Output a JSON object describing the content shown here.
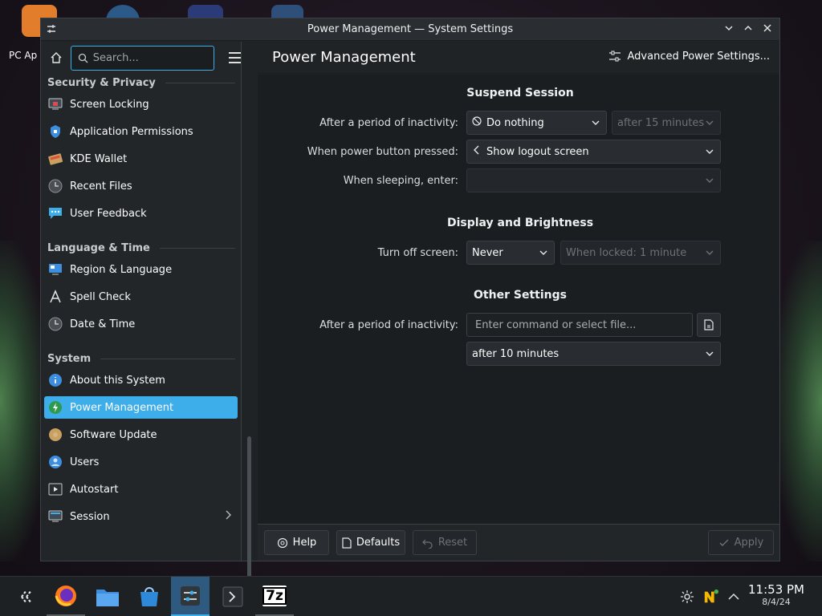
{
  "desktop": {
    "icon_label": "PC Ap"
  },
  "window": {
    "title": "Power Management — System Settings"
  },
  "sidebar": {
    "search_placeholder": "Search...",
    "sections": [
      {
        "title": "Security & Privacy"
      },
      {
        "title": "Language & Time"
      },
      {
        "title": "System"
      }
    ],
    "items": [
      {
        "label": "Screen Locking"
      },
      {
        "label": "Application Permissions"
      },
      {
        "label": "KDE Wallet"
      },
      {
        "label": "Recent Files"
      },
      {
        "label": "User Feedback"
      },
      {
        "label": "Region & Language"
      },
      {
        "label": "Spell Check"
      },
      {
        "label": "Date & Time"
      },
      {
        "label": "About this System"
      },
      {
        "label": "Power Management"
      },
      {
        "label": "Software Update"
      },
      {
        "label": "Users"
      },
      {
        "label": "Autostart"
      },
      {
        "label": "Session"
      }
    ]
  },
  "header": {
    "page_title": "Power Management",
    "advanced_label": "Advanced Power Settings..."
  },
  "suspend": {
    "title": "Suspend Session",
    "inactivity_label": "After a period of inactivity:",
    "inactivity_value": "Do nothing",
    "inactivity_time": "after 15 minutes",
    "power_button_label": "When power button pressed:",
    "power_button_value": "Show logout screen",
    "sleeping_label": "When sleeping, enter:",
    "sleeping_value": ""
  },
  "display": {
    "title": "Display and Brightness",
    "turn_off_label": "Turn off screen:",
    "turn_off_value": "Never",
    "when_locked_value": "When locked: 1 minute"
  },
  "other": {
    "title": "Other Settings",
    "inactivity_label": "After a period of inactivity:",
    "command_placeholder": "Enter command or select file...",
    "after_value": "after 10 minutes"
  },
  "footer": {
    "help": "Help",
    "defaults": "Defaults",
    "reset": "Reset",
    "apply": "Apply"
  },
  "taskbar": {
    "time": "11:53 PM",
    "date": "8/4/24",
    "app_7z_label": "7z"
  },
  "colors": {
    "accent": "#3daee9",
    "window_bg": "#202326",
    "content_bg": "#1b1e20"
  }
}
